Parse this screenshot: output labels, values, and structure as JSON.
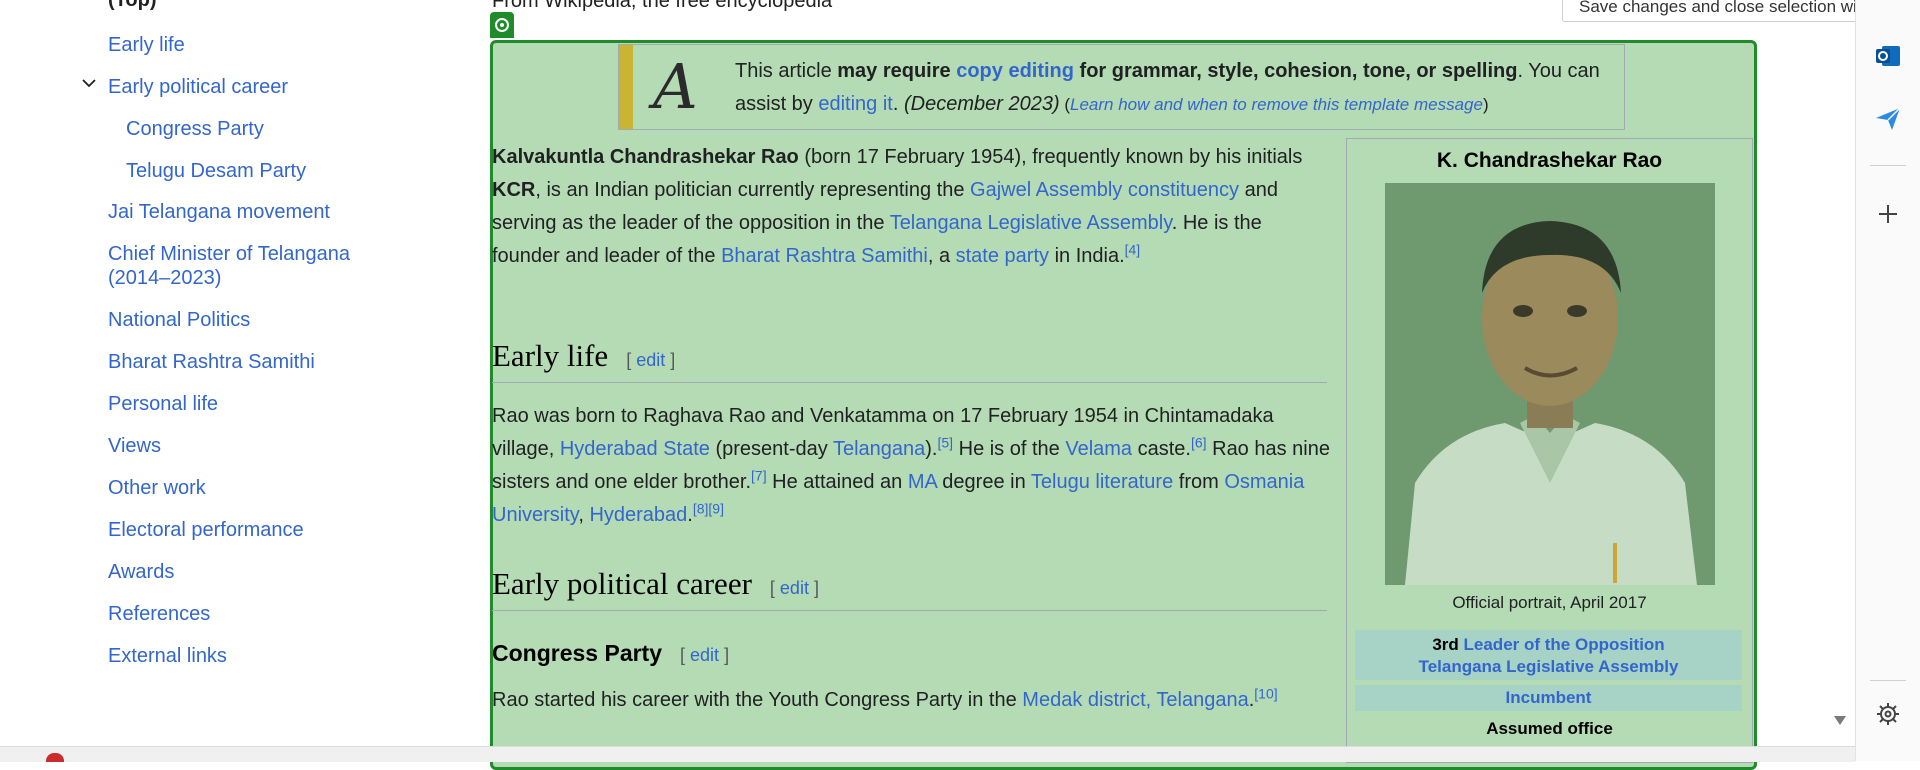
{
  "toc": {
    "top_label": "(Top)",
    "items": [
      {
        "label": "Early life",
        "level": 1
      },
      {
        "label": "Early political career",
        "level": 1
      },
      {
        "label": "Congress Party",
        "level": 2
      },
      {
        "label": "Telugu Desam Party",
        "level": 2
      },
      {
        "label": "Jai Telangana movement",
        "level": 1
      },
      {
        "label": "Chief Minister of Telangana",
        "label2": "(2014–2023)",
        "level": 1
      },
      {
        "label": "National Politics",
        "level": 1
      },
      {
        "label": "Bharat Rashtra Samithi",
        "level": 1
      },
      {
        "label": "Personal life",
        "level": 1
      },
      {
        "label": "Views",
        "level": 1
      },
      {
        "label": "Other work",
        "level": 1
      },
      {
        "label": "Electoral performance",
        "level": 1
      },
      {
        "label": "Awards",
        "level": 1
      },
      {
        "label": "References",
        "level": 1
      },
      {
        "label": "External links",
        "level": 1
      }
    ]
  },
  "tagline": "From Wikipedia, the free encyclopedia",
  "tooltip": "Save changes and close selection wizard.",
  "notice": {
    "glyph": "A",
    "t1": "This article ",
    "t2": "may require ",
    "t3": "copy editing",
    "t4": " for grammar, style, cohesion, tone, or spelling",
    "t5": ". You can assist by ",
    "t6": "editing it",
    "t7": ". ",
    "t8": "(December 2023)",
    "t9": " (",
    "t10": "Learn how and when to remove this template message",
    "t11": ")"
  },
  "intro": {
    "name": "Kalvakuntla Chandrashekar Rao",
    "a": " (born 17 February 1954), frequently known by his initials ",
    "kcr": "KCR",
    "b": ", is an Indian politician currently representing the ",
    "l1": "Gajwel Assembly constituency",
    "c": " and serving as the leader of the opposition in the ",
    "l2": "Telangana Legislative Assembly",
    "d": ". He is the founder and leader of the ",
    "l3": "Bharat Rashtra Samithi",
    "e": ", a ",
    "l4": "state party",
    "f": " in India.",
    "ref": "[4]"
  },
  "early_life": {
    "heading": "Early life",
    "edit": "edit",
    "p1": "Rao was born to Raghava Rao and Venkatamma on 17 February 1954 in Chintamadaka village, ",
    "l1": "Hyderabad State",
    "p2": " (present-day ",
    "l2": "Telangana",
    "p3": ").",
    "r5": "[5]",
    "p4": " He is of the ",
    "l3": "Velama",
    "p5": " caste.",
    "r6": "[6]",
    "p6": " Rao has nine sisters and one elder brother.",
    "r7": "[7]",
    "p7": " He attained an ",
    "l4": "MA",
    "p8": " degree in ",
    "l5": "Telugu literature",
    "p9": " from ",
    "l6": "Osmania University",
    "p10": ", ",
    "l7": "Hyderabad",
    "p11": ".",
    "r89": "[8][9]"
  },
  "early_political": {
    "heading": "Early political career",
    "edit": "edit"
  },
  "congress": {
    "heading": "Congress Party",
    "edit": "edit",
    "p1": "Rao started his career with the Youth Congress Party in the ",
    "l1": "Medak district, Telangana",
    "p2": ".",
    "r10": "[10]"
  },
  "infobox": {
    "title": "K. Chandrashekar Rao",
    "caption": "Official portrait, April 2017",
    "office_prefix": "3rd",
    "office_l1": "Leader of the Opposition",
    "office_l2": "Telangana Legislative Assembly",
    "incumbent": "Incumbent",
    "assumed": "Assumed office"
  },
  "colors": {
    "link": "#3366cc",
    "overlay": "#1e8c2a",
    "notice_bar": "#c9b531"
  }
}
